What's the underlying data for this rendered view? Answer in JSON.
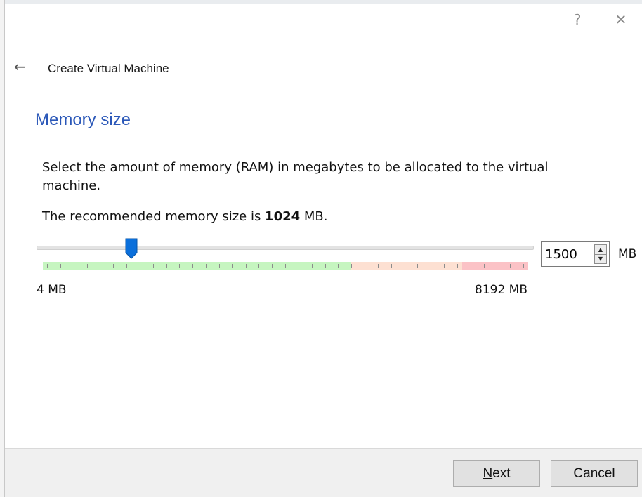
{
  "window": {
    "help_label": "?",
    "close_label": "✕"
  },
  "header": {
    "back_icon": "arrow-left-icon",
    "title": "Create Virtual Machine"
  },
  "page": {
    "heading": "Memory size",
    "description": "Select the amount of memory (RAM) in megabytes to be allocated to the virtual machine.",
    "recommend_prefix": "The recommended memory size is ",
    "recommend_value": "1024",
    "recommend_suffix": " MB."
  },
  "slider": {
    "min_label": "4 MB",
    "max_label": "8192 MB",
    "min_value": 4,
    "max_value": 8192,
    "current_value": 1500,
    "green_fraction": 0.635,
    "orange_fraction": 0.23,
    "red_fraction": 0.135,
    "colors": {
      "thumb": "#0a6fdb",
      "green": "#c6f5c0",
      "orange": "#fde0d2",
      "red": "#fbc2c6"
    }
  },
  "spinbox": {
    "value": "1500",
    "unit": "MB",
    "up_icon": "spin-up-icon",
    "down_icon": "spin-down-icon"
  },
  "footer": {
    "next_mnemonic": "N",
    "next_rest": "ext",
    "cancel_label": "Cancel"
  }
}
